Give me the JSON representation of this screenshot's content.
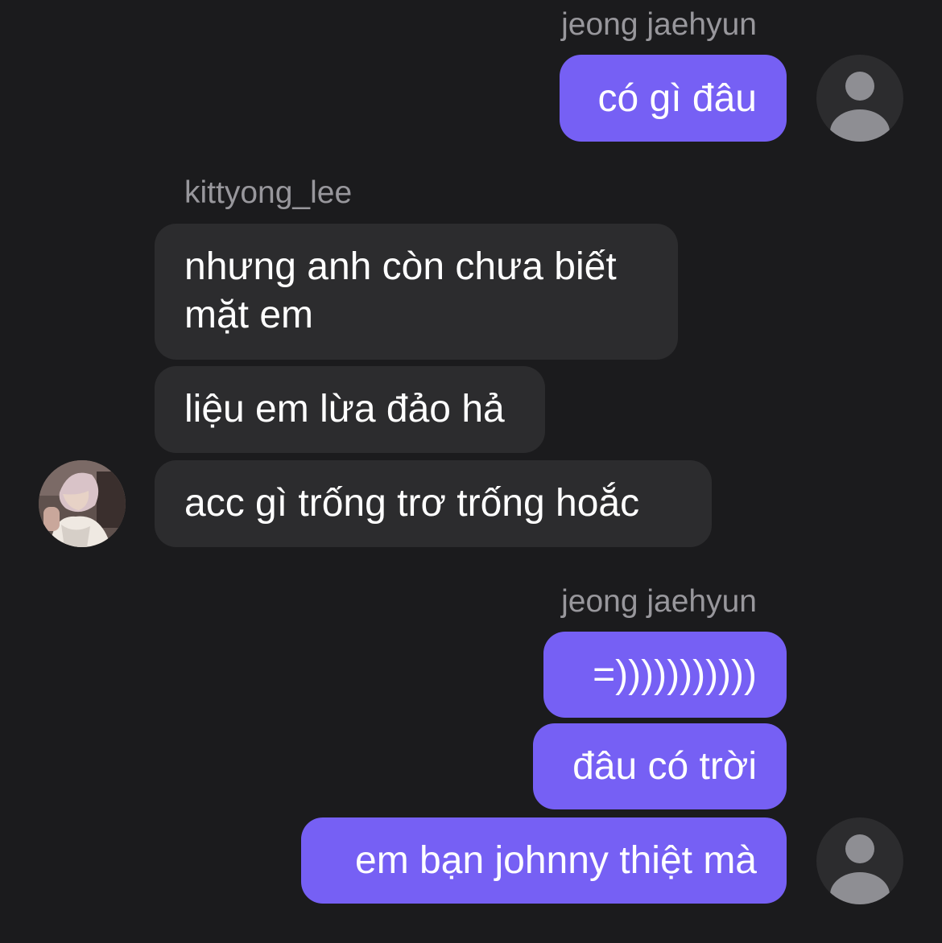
{
  "messages": [
    {
      "sender": "jeong jaehyun",
      "text": "có gì đâu"
    },
    {
      "sender": "kittyong_lee",
      "lines": [
        "nhưng anh còn chưa biết",
        "mặt em"
      ]
    },
    {
      "text": "liệu em lừa đảo hả"
    },
    {
      "text": "acc gì trống trơ trống hoắc"
    },
    {
      "sender": "jeong jaehyun",
      "text": "=)))))))))))"
    },
    {
      "text": "đâu có trời"
    },
    {
      "text": "em bạn johnny thiệt mà"
    }
  ],
  "colors": {
    "background": "#1b1b1d",
    "outgoing_bubble": "#7660f4",
    "incoming_bubble": "#2c2c2e",
    "sender_name": "#98979c"
  },
  "icons": {
    "default_avatar": "person-silhouette-icon",
    "contact_avatar": "profile-photo"
  }
}
